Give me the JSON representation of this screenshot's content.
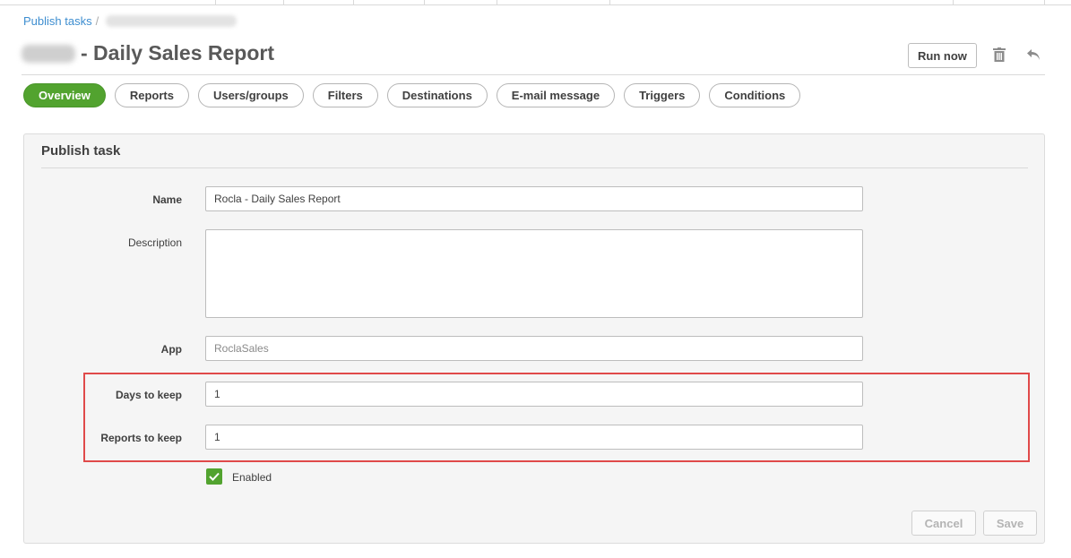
{
  "breadcrumb": {
    "link": "Publish tasks",
    "separator": "/"
  },
  "header": {
    "title": "- Daily Sales Report",
    "run_now_label": "Run now",
    "delete_icon": "trash-icon",
    "back_icon": "undo-arrow-icon"
  },
  "tabs": [
    {
      "label": "Overview",
      "active": true
    },
    {
      "label": "Reports"
    },
    {
      "label": "Users/groups"
    },
    {
      "label": "Filters"
    },
    {
      "label": "Destinations"
    },
    {
      "label": "E-mail message"
    },
    {
      "label": "Triggers"
    },
    {
      "label": "Conditions"
    }
  ],
  "panel": {
    "title": "Publish task",
    "fields": {
      "name": {
        "label": "Name",
        "value": "Rocla - Daily Sales Report"
      },
      "description": {
        "label": "Description",
        "value": ""
      },
      "app": {
        "label": "App",
        "value": "RoclaSales"
      },
      "days_to_keep": {
        "label": "Days to keep",
        "value": "1"
      },
      "reports_to_keep": {
        "label": "Reports to keep",
        "value": "1"
      }
    },
    "enabled": {
      "label": "Enabled",
      "checked": true
    },
    "cancel_label": "Cancel",
    "save_label": "Save"
  },
  "colors": {
    "accent_green": "#52a32f",
    "highlight_red": "#e04a4a",
    "link_blue": "#3e8ed0"
  }
}
